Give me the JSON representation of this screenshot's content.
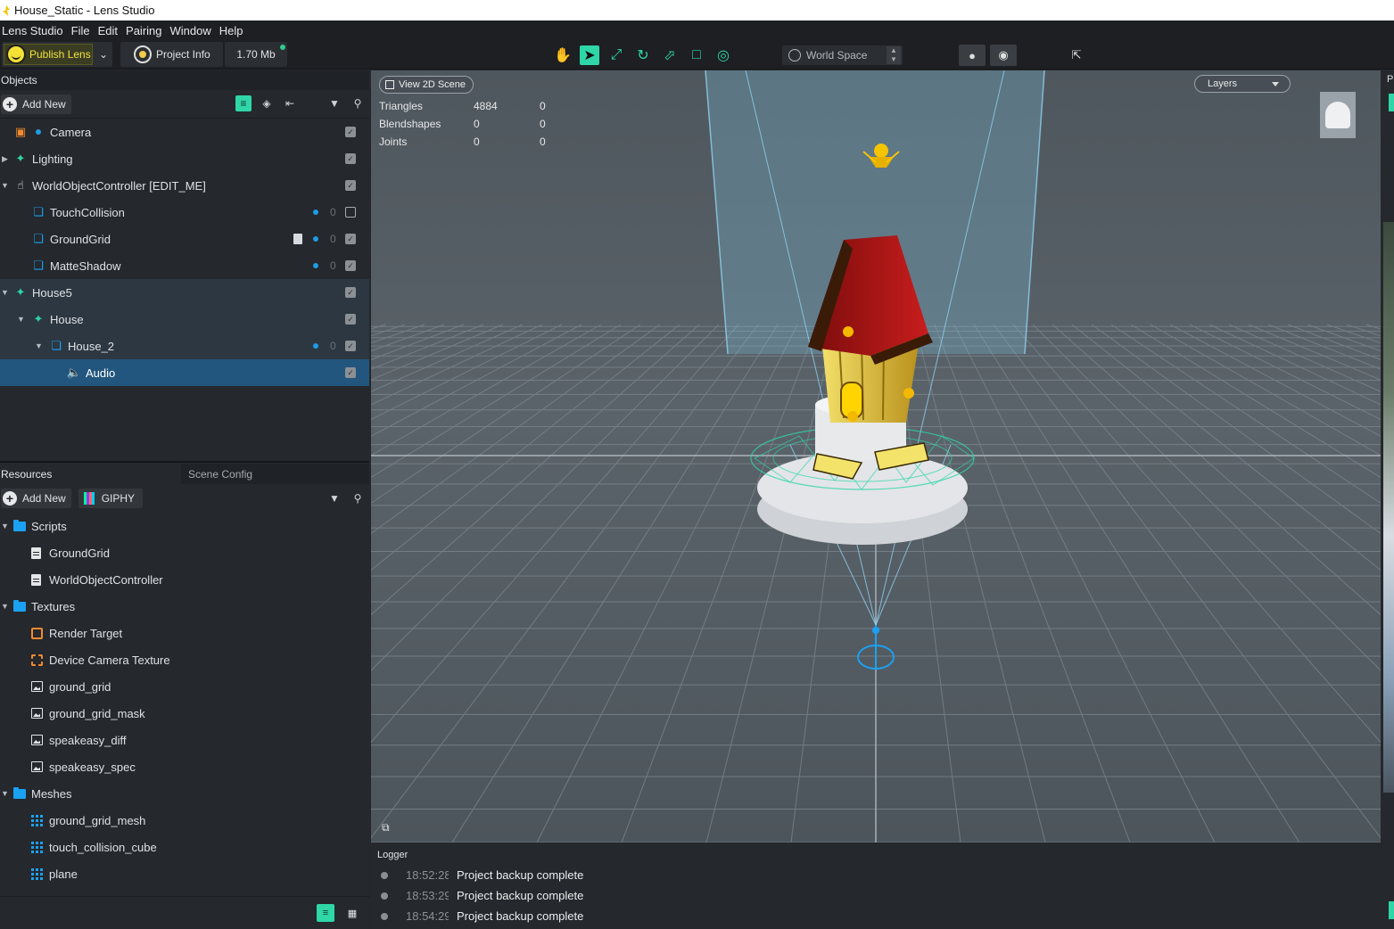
{
  "window": {
    "title": "House_Static - Lens Studio"
  },
  "menu": [
    "Lens Studio",
    "File",
    "Edit",
    "Pairing",
    "Window",
    "Help"
  ],
  "toolbar": {
    "publish_label": "Publish Lens",
    "project_info_label": "Project Info",
    "size_label": "1.70 Mb",
    "space_select": "World Space"
  },
  "objects_panel": {
    "title": "Objects",
    "add_new": "Add New",
    "items": [
      {
        "label": "Camera",
        "icon": "camera-icon"
      },
      {
        "label": "Lighting",
        "icon": "light-icon"
      },
      {
        "label": "WorldObjectController [EDIT_ME]",
        "icon": "hand-icon"
      },
      {
        "label": "TouchCollision",
        "icon": "cube-icon",
        "count": "0"
      },
      {
        "label": "GroundGrid",
        "icon": "cube-icon",
        "count": "0"
      },
      {
        "label": "MatteShadow",
        "icon": "cube-icon",
        "count": "0"
      },
      {
        "label": "House5",
        "icon": "prefab-icon"
      },
      {
        "label": "House",
        "icon": "prefab-icon"
      },
      {
        "label": "House_2",
        "icon": "cube-icon",
        "count": "0"
      },
      {
        "label": "Audio",
        "icon": "audio-icon"
      }
    ]
  },
  "resources_panel": {
    "tabs": [
      "Resources",
      "Scene Config"
    ],
    "add_new": "Add New",
    "giphy": "GIPHY",
    "items": [
      {
        "label": "Scripts",
        "type": "folder"
      },
      {
        "label": "GroundGrid",
        "type": "script"
      },
      {
        "label": "WorldObjectController",
        "type": "script"
      },
      {
        "label": "Textures",
        "type": "folder"
      },
      {
        "label": "Render Target",
        "type": "render-target"
      },
      {
        "label": "Device Camera Texture",
        "type": "device-texture"
      },
      {
        "label": "ground_grid",
        "type": "image"
      },
      {
        "label": "ground_grid_mask",
        "type": "image"
      },
      {
        "label": "speakeasy_diff",
        "type": "image"
      },
      {
        "label": "speakeasy_spec",
        "type": "image"
      },
      {
        "label": "Meshes",
        "type": "folder"
      },
      {
        "label": "ground_grid_mesh",
        "type": "mesh"
      },
      {
        "label": "touch_collision_cube",
        "type": "mesh"
      },
      {
        "label": "plane",
        "type": "mesh"
      }
    ]
  },
  "viewport": {
    "view2d_label": "View 2D Scene",
    "layers_label": "Layers",
    "stats": [
      {
        "name": "Triangles",
        "a": "4884",
        "b": "0"
      },
      {
        "name": "Blendshapes",
        "a": "0",
        "b": "0"
      },
      {
        "name": "Joints",
        "a": "0",
        "b": "0"
      }
    ]
  },
  "logger": {
    "title": "Logger",
    "entries": [
      {
        "time": "18:52:28",
        "message": "Project backup complete"
      },
      {
        "time": "18:53:29",
        "message": "Project backup complete"
      },
      {
        "time": "18:54:29",
        "message": "Project backup complete"
      }
    ]
  },
  "right_panel": {
    "label": "P"
  },
  "colors": {
    "accent": "#2fd6a8",
    "selection": "#23567e",
    "publish": "#f4e136"
  }
}
